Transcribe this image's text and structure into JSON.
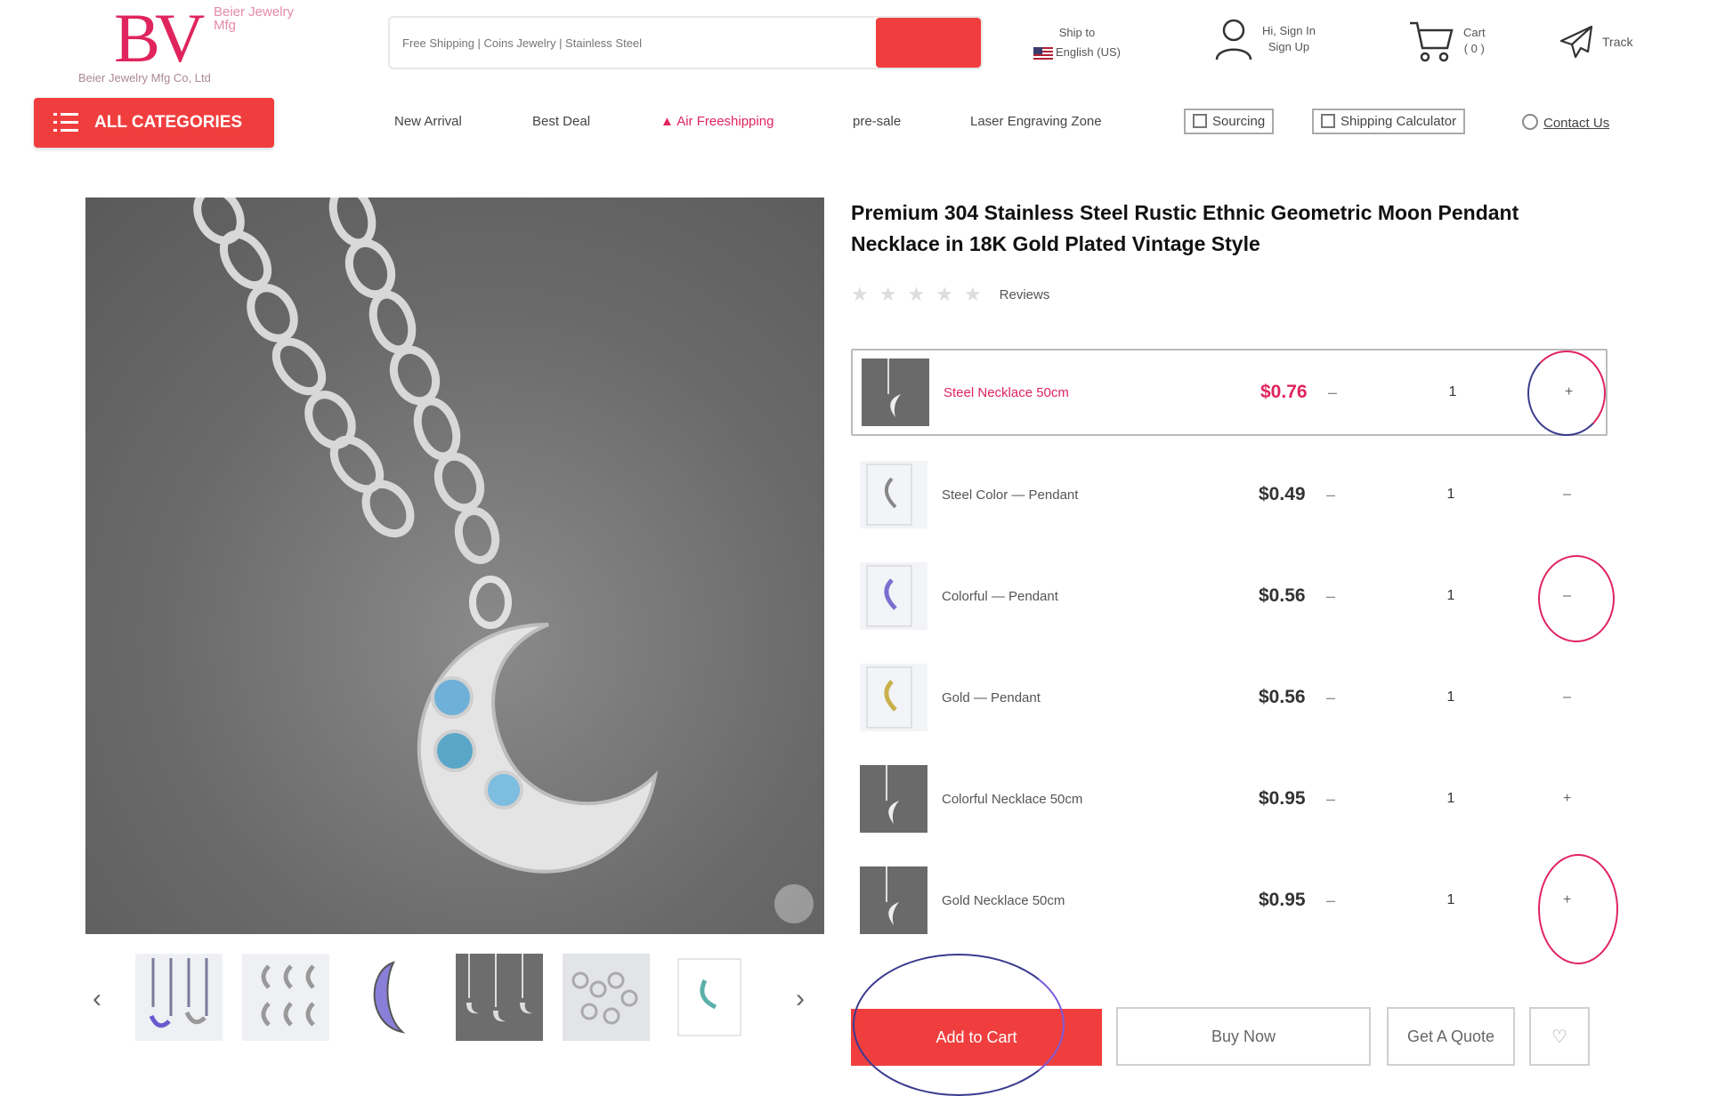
{
  "header": {
    "logo_mark": "BV",
    "logo_side": "Beier Jewelry Mfg",
    "logo_tagline": "Beier Jewelry Mfg Co, Ltd",
    "search_placeholder": "Free Shipping | Coins Jewelry | Stainless Steel",
    "ship_to_label": "Ship to",
    "ship_to_value": "English (US)",
    "account_line1": "Hi, Sign In",
    "account_line2": "Sign Up",
    "cart_label": "Cart",
    "cart_count": "( 0 )",
    "track_label": "Track"
  },
  "nav": {
    "all_categories": "ALL CATEGORIES",
    "items": [
      "New Arrival",
      "Best Deal",
      "Air Freeshipping",
      "pre-sale",
      "Laser Engraving Zone",
      "Sourcing",
      "Shipping Calculator",
      "Contact Us"
    ]
  },
  "product": {
    "title": "Premium 304 Stainless Steel Rustic Ethnic Geometric Moon Pendant Necklace in 18K Gold Plated Vintage Style",
    "reviews_label": "Reviews",
    "variants": [
      {
        "name": "Steel Necklace 50cm",
        "price": "$0.76",
        "qty": "1",
        "minus": "–",
        "plus": "+"
      },
      {
        "name": "Steel Color — Pendant",
        "price": "$0.49",
        "qty": "1",
        "minus": "–",
        "plus": "–"
      },
      {
        "name": "Colorful — Pendant",
        "price": "$0.56",
        "qty": "1",
        "minus": "–",
        "plus": "–"
      },
      {
        "name": "Gold — Pendant",
        "price": "$0.56",
        "qty": "1",
        "minus": "–",
        "plus": "–"
      },
      {
        "name": "Colorful Necklace 50cm",
        "price": "$0.95",
        "qty": "1",
        "minus": "–",
        "plus": "+"
      },
      {
        "name": "Gold Necklace 50cm",
        "price": "$0.95",
        "qty": "1",
        "minus": "–",
        "plus": "+"
      }
    ]
  },
  "actions": {
    "add_to_cart": "Add to Cart",
    "buy_now": "Buy Now",
    "quote": "Get A Quote",
    "fav_icon": "heart-icon"
  },
  "thumb_nav": {
    "prev": "‹",
    "next": "›"
  },
  "colors": {
    "accent": "#f03e3e",
    "brand_pink": "#e0245e",
    "annotation_red": "#e0245e",
    "annotation_blue": "#3b3b8f"
  }
}
